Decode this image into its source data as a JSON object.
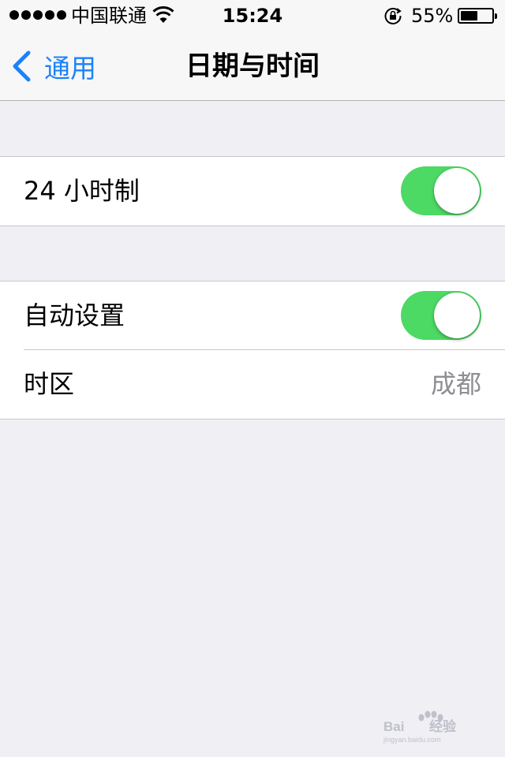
{
  "status_bar": {
    "carrier": "中国联通",
    "time": "15:24",
    "battery_percent": "55%",
    "battery_level": 0.55,
    "icons": [
      "signal-dots-icon",
      "wifi-icon",
      "rotation-lock-icon",
      "battery-icon"
    ]
  },
  "nav": {
    "back_label": "通用",
    "title": "日期与时间"
  },
  "settings": {
    "hour24": {
      "label": "24 小时制",
      "enabled": true
    },
    "auto_set": {
      "label": "自动设置",
      "enabled": true
    },
    "timezone": {
      "label": "时区",
      "value": "成都"
    }
  },
  "colors": {
    "accent": "#1a82fb",
    "toggle_on": "#4cd964",
    "background": "#efeff4"
  },
  "watermark": {
    "brand": "Bai du 经验",
    "url": "jingyan.baidu.com"
  }
}
